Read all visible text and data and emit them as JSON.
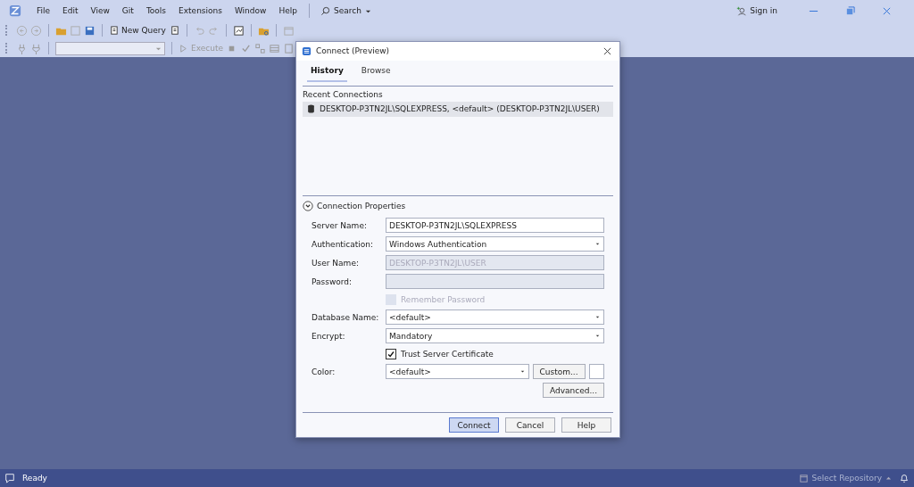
{
  "menu": {
    "items": [
      "File",
      "Edit",
      "View",
      "Git",
      "Tools",
      "Extensions",
      "Window",
      "Help"
    ],
    "search": "Search",
    "sign_in": "Sign in"
  },
  "toolbar": {
    "new_query": "New Query",
    "execute": {
      "label": "Execute",
      "disabled": true
    }
  },
  "dialog": {
    "title": "Connect (Preview)",
    "tabs": [
      {
        "label": "History",
        "selected": true
      },
      {
        "label": "Browse",
        "selected": false
      }
    ],
    "recent_heading": "Recent Connections",
    "connections": [
      {
        "label": "DESKTOP-P3TN2JL\\SQLEXPRESS, <default> (DESKTOP-P3TN2JL\\USER)",
        "selected": true
      }
    ],
    "properties": {
      "label": "Connection Properties",
      "expanded": true
    },
    "fields": [
      {
        "kind": "text",
        "label": "Server Name:",
        "value": "DESKTOP-P3TN2JL\\SQLEXPRESS",
        "disabled": false
      },
      {
        "kind": "dropdown",
        "label": "Authentication:",
        "value": "Windows Authentication"
      },
      {
        "kind": "text",
        "label": "User Name:",
        "value": "DESKTOP-P3TN2JL\\USER",
        "disabled": true
      },
      {
        "kind": "text",
        "label": "Password:",
        "disabled": true
      },
      {
        "kind": "checkbox",
        "label": "Remember Password",
        "checked": false,
        "disabled": true
      },
      {
        "kind": "dropdown",
        "label": "Database Name:",
        "value": "<default>"
      },
      {
        "kind": "dropdown",
        "label": "Encrypt:",
        "value": "Mandatory"
      },
      {
        "kind": "checkbox",
        "label": "Trust Server Certificate",
        "checked": true,
        "disabled": false
      },
      {
        "kind": "color",
        "label": "Color:",
        "value": "<default>",
        "button": "Custom..."
      },
      {
        "kind": "button",
        "label": "Advanced..."
      }
    ],
    "buttons": [
      {
        "label": "Connect",
        "default": true
      },
      {
        "label": "Cancel",
        "default": false
      },
      {
        "label": "Help",
        "default": false
      }
    ]
  },
  "status": {
    "text": "Ready",
    "repository": "Select Repository"
  }
}
